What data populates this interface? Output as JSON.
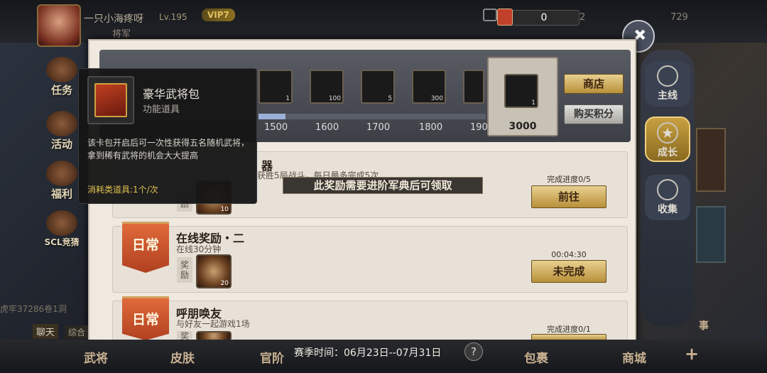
{
  "player": {
    "name": "一只小海疼呀",
    "level": "Lv.195",
    "vip": "VIP7",
    "rank": "将军"
  },
  "topbar": {
    "coin": "0",
    "num1": "2",
    "num2": "729"
  },
  "leftnav": [
    "任务",
    "活动",
    "福利",
    "SCL竞猜"
  ],
  "progress": {
    "ticks": [
      "1500",
      "1600",
      "1700",
      "1800",
      "190"
    ],
    "items": [
      {
        "count": "1"
      },
      {
        "count": "100"
      },
      {
        "count": "5"
      },
      {
        "count": "300"
      },
      {
        "count": ""
      }
    ],
    "big": {
      "count": "1",
      "value": "3000"
    },
    "shop": "商店",
    "buy": "购买积分",
    "fill_fraction": 0.12
  },
  "tooltip": {
    "name": "豪华武将包",
    "type": "功能道具",
    "desc": "该卡包开启后可一次性获得五名随机武将，拿到稀有武将的机会大大提高",
    "consume": "消耗类道具:1个/次"
  },
  "quests": [
    {
      "title": "器",
      "sub": "获胜5局战斗，每日最多完成5次",
      "reward_label": "励",
      "count": "10",
      "status": "完成进度0/5",
      "button": "前往"
    },
    {
      "tag": "日常",
      "title": "在线奖励・二",
      "sub": "在线30分钟",
      "reward_label": "奖励",
      "count": "20",
      "status": "00:04:30",
      "button": "未完成"
    },
    {
      "tag": "日常",
      "title": "呼朋唤友",
      "sub": "与好友一起游戏1场",
      "reward_label": "奖",
      "count": "",
      "status": "完成进度0/1",
      "button": ""
    }
  ],
  "notice": "此奖励需要进阶军典后可领取",
  "righttabs": [
    "主线",
    "成长",
    "收集"
  ],
  "bottom": {
    "season": "赛季时间：06月23日--07月31日",
    "help": "?",
    "items": [
      "武将",
      "皮肤",
      "官阶",
      "包裹",
      "商城"
    ],
    "chat": "聊天",
    "chat2": "综合",
    "side": "虎牢37286卷1洞",
    "edge": "事"
  },
  "colors": {
    "gold": "#e8d090",
    "accent": "#e06a3a"
  }
}
